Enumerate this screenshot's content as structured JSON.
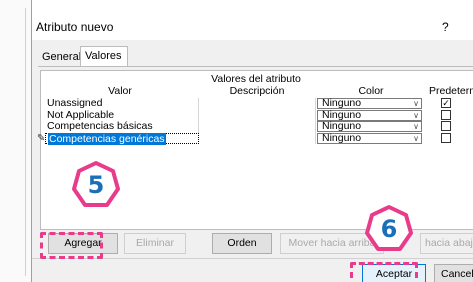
{
  "dialog": {
    "title": "Atributo nuevo",
    "help": "?"
  },
  "tabs": [
    {
      "label": "General",
      "active": false
    },
    {
      "label": "Valores",
      "active": true
    }
  ],
  "table": {
    "group_header": "Valores del atributo",
    "columns": [
      "Valor",
      "Descripción",
      "Color",
      "Predetermin"
    ],
    "rows": [
      {
        "valor": "Unassigned",
        "descripcion": "",
        "color": "Ninguno",
        "predeterminado": true
      },
      {
        "valor": "Not Applicable",
        "descripcion": "",
        "color": "Ninguno",
        "predeterminado": false
      },
      {
        "valor": "Competencias básicas",
        "descripcion": "",
        "color": "Ninguno",
        "predeterminado": false
      },
      {
        "valor": "Competencias genéricas",
        "descripcion": "",
        "color": "Ninguno",
        "predeterminado": false,
        "selected": true
      }
    ]
  },
  "buttons": {
    "agregar": "Agregar",
    "eliminar": "Eliminar",
    "orden": "Orden",
    "mover_arriba": "Mover hacia arriba",
    "mover_abajo": "hacia abajo",
    "aceptar": "Aceptar",
    "cancelar": "Cancelar"
  },
  "callouts": {
    "step5": "5",
    "step6": "6"
  },
  "colors": {
    "callout_border": "#e83b8a",
    "callout_text": "#1a6fb8",
    "selection": "#0078d7"
  },
  "icons": {
    "edit": "pencil-icon",
    "dropdown": "chevron-down-icon",
    "checkbox": "checkbox-icon"
  }
}
